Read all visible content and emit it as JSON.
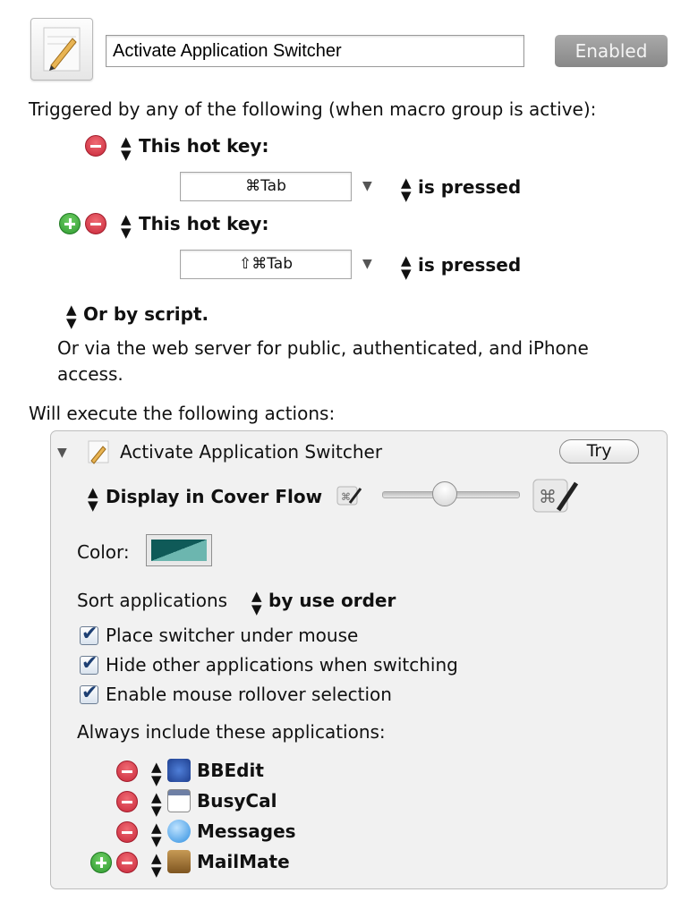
{
  "macro": {
    "name": "Activate Application Switcher",
    "enabled_label": "Enabled",
    "icon": "macro-pencil-icon"
  },
  "triggers": {
    "heading": "Triggered by any of the following (when macro group is active):",
    "hotkeys": [
      {
        "type_label": "This hot key:",
        "keys": "⌘Tab",
        "condition": "is pressed"
      },
      {
        "type_label": "This hot key:",
        "keys": "⇧⌘Tab",
        "condition": "is pressed"
      }
    ],
    "script_label": "Or by script.",
    "web_server_text_line1": "Or via the web server for public, authenticated, and iPhone",
    "web_server_text_line2": "access."
  },
  "actions": {
    "heading": "Will execute the following actions:",
    "action_title": "Activate Application Switcher",
    "try_label": "Try",
    "display_mode": "Display in Cover Flow",
    "size_slider_value": 0.45,
    "color_label": "Color:",
    "color_dark": "#0f5a58",
    "color_light": "#6cb6af",
    "sort_label": "Sort applications",
    "sort_value": "by use order",
    "options": [
      {
        "label": "Place switcher under mouse",
        "checked": true
      },
      {
        "label": "Hide other applications when switching",
        "checked": true
      },
      {
        "label": "Enable mouse rollover selection",
        "checked": true
      }
    ],
    "always_include_label": "Always include these applications:",
    "apps": [
      {
        "name": "BBEdit",
        "icon": "bbedit-icon"
      },
      {
        "name": "BusyCal",
        "icon": "busycal-icon"
      },
      {
        "name": "Messages",
        "icon": "messages-icon"
      },
      {
        "name": "MailMate",
        "icon": "mailmate-icon"
      }
    ]
  }
}
